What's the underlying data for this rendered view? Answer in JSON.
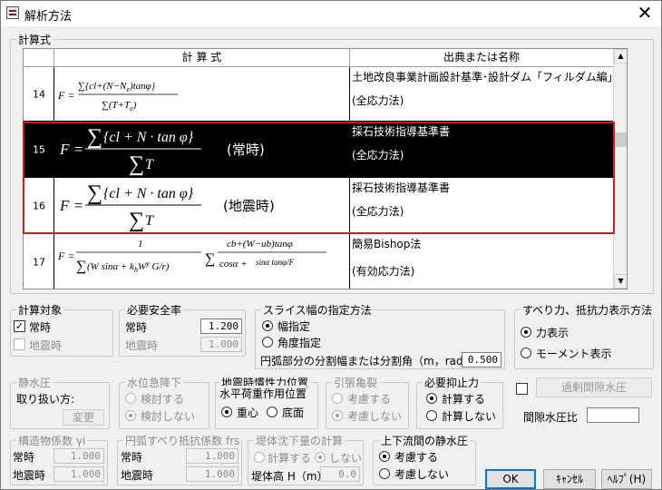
{
  "window": {
    "title": "解析方法"
  },
  "formula_section": {
    "label": "計算式",
    "table": {
      "headers": [
        "計 算 式",
        "出典または名称"
      ],
      "rows": [
        {
          "no": "14",
          "formula": "F = Σ{cl+(N−Ne)tanφ} / Σ(T+Te)",
          "source": "土地改良事業計画設計基準･設計ダム「フィルダム編」",
          "method": "(全応力法)",
          "note": ""
        },
        {
          "no": "15",
          "formula": "F = Σ{cl + N·tanφ} / ΣT",
          "source": "採石技術指導基準書",
          "method": "(全応力法)",
          "note": "(常時)"
        },
        {
          "no": "16",
          "formula": "F = Σ{cl + N·tanφ} / ΣT",
          "source": "採石技術指導基準書",
          "method": "(全応力法)",
          "note": "(地震時)"
        },
        {
          "no": "17",
          "formula": "Bishop",
          "source": "簡易Bishop法",
          "method": "(有効応力法)",
          "note": ""
        }
      ]
    }
  },
  "calc_target": {
    "label": "計算対象",
    "normal": "常時",
    "quake": "地震時"
  },
  "safety": {
    "label": "必要安全率",
    "normal_label": "常時",
    "normal_value": "1.200",
    "quake_label": "地震時",
    "quake_value": "1.000"
  },
  "slice": {
    "label": "スライス幅の指定方法",
    "opt1": "幅指定",
    "opt2": "角度指定",
    "div_label": "円弧部分の分割幅または分割角（m，rad）",
    "div_value": "0.500"
  },
  "display": {
    "label": "すべり力、抵抗力表示方法",
    "opt1": "力表示",
    "opt2": "モーメント表示"
  },
  "excess": {
    "button": "過剰間隙水圧",
    "ratio_label": "間隙水圧比",
    "ratio_value": ""
  },
  "static_water": {
    "label": "静水圧",
    "handling": "取り扱い方:",
    "change_button": "変更"
  },
  "drawdown": {
    "label": "水位急降下",
    "opt1": "検討する",
    "opt2": "検討しない"
  },
  "inertia": {
    "label1": "地震時慣性力位置",
    "label2": "水平荷重作用位置",
    "opt1": "重心",
    "opt2": "底面"
  },
  "tension_crack": {
    "label": "引張亀裂",
    "opt1": "考慮する",
    "opt2": "考慮しない"
  },
  "suppression": {
    "label": "必要抑止力",
    "opt1": "計算する",
    "opt2": "計算しない"
  },
  "seismic_coef": {
    "label": "構造物係数 γi",
    "normal_label": "常時",
    "normal_value": "1.000",
    "quake_label": "地震時",
    "quake_value": "1.000"
  },
  "arc_coef": {
    "label": "円弧すべり抵抗係数 frs",
    "normal_label": "常時",
    "normal_value": "1.000",
    "quake_label": "地震時",
    "quake_value": "1.000"
  },
  "settlement": {
    "label": "堤体沈下量の計算",
    "opt1": "計算する",
    "opt2": "しない",
    "height_label": "堤体高 H（m）",
    "height_value": "0.0"
  },
  "downstream": {
    "label": "上下流間の静水圧",
    "opt1": "考慮する",
    "opt2": "考慮しない"
  },
  "buttons": {
    "ok": "OK",
    "cancel": "ｷｬﾝｾﾙ",
    "help": "ﾍﾙﾌﾟ(H)"
  }
}
